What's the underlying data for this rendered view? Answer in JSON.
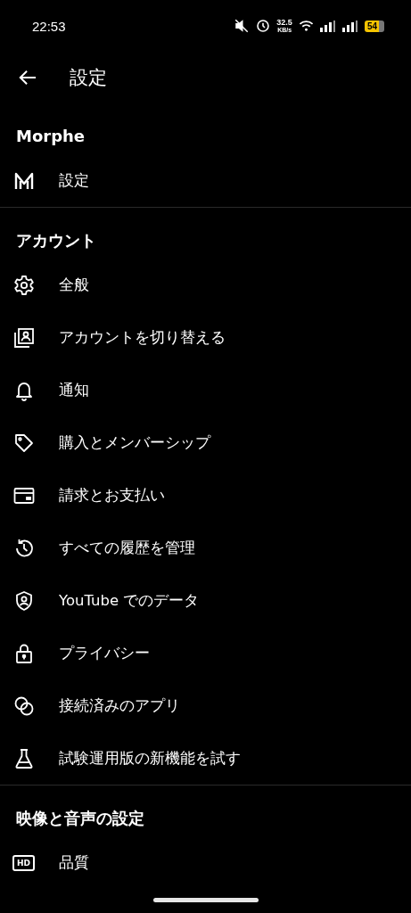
{
  "status_bar": {
    "time": "22:53",
    "speed": "32.5",
    "speed_unit": "KB/s",
    "battery": "54"
  },
  "header": {
    "title": "設定"
  },
  "sections": [
    {
      "title": "Morphe",
      "items": [
        {
          "kind": "m-logo",
          "label": "設定"
        }
      ]
    },
    {
      "title": "アカウント",
      "items": [
        {
          "kind": "gear",
          "label": "全般"
        },
        {
          "kind": "account-switch",
          "label": "アカウントを切り替える"
        },
        {
          "kind": "bell",
          "label": "通知"
        },
        {
          "kind": "tag",
          "label": "購入とメンバーシップ"
        },
        {
          "kind": "card",
          "label": "請求とお支払い"
        },
        {
          "kind": "history",
          "label": "すべての履歴を管理"
        },
        {
          "kind": "shield",
          "label": "YouTube でのデータ"
        },
        {
          "kind": "lock",
          "label": "プライバシー"
        },
        {
          "kind": "circles",
          "label": "接続済みのアプリ"
        },
        {
          "kind": "flask",
          "label": "試験運用版の新機能を試す"
        }
      ]
    },
    {
      "title": "映像と音声の設定",
      "items": [
        {
          "kind": "hd",
          "badge": "HD",
          "label": "品質"
        }
      ]
    }
  ]
}
